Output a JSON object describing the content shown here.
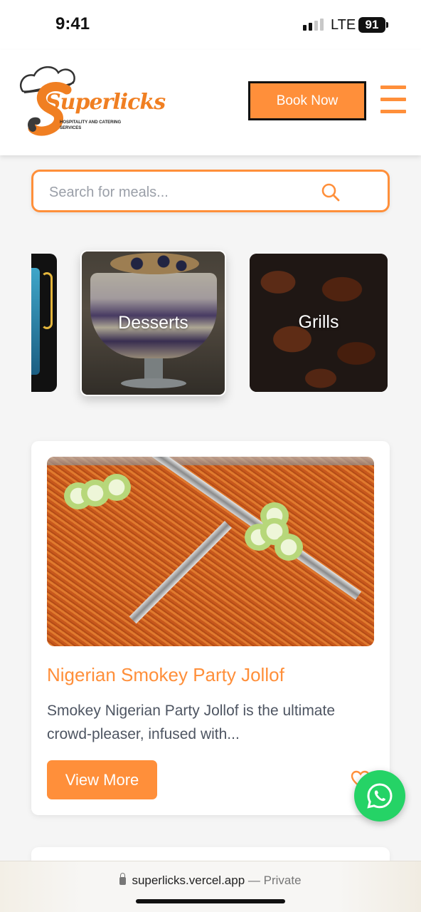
{
  "status_bar": {
    "time": "9:41",
    "network": "LTE",
    "battery": "91"
  },
  "header": {
    "logo_text": "Superlicks",
    "logo_subtitle": "HOSPITALITY AND CATERING SERVICES",
    "book_label": "Book Now",
    "menu_icon": "hamburger-menu-icon"
  },
  "search": {
    "placeholder": "Search for meals...",
    "icon": "search-icon"
  },
  "categories": [
    {
      "label": ""
    },
    {
      "label": "Desserts"
    },
    {
      "label": "Grills"
    }
  ],
  "product": {
    "title": "Nigerian Smokey Party Jollof",
    "description": "Smokey Nigerian Party Jollof is the ultimate crowd-pleaser, infused with...",
    "button_label": "View More",
    "favorite_icon": "heart-icon"
  },
  "whatsapp": {
    "icon": "whatsapp-icon",
    "color": "#25d366"
  },
  "browser": {
    "url": "superlicks.vercel.app",
    "mode": "— Private"
  },
  "colors": {
    "accent": "#ff8f3a",
    "text_muted": "#4e5562"
  }
}
